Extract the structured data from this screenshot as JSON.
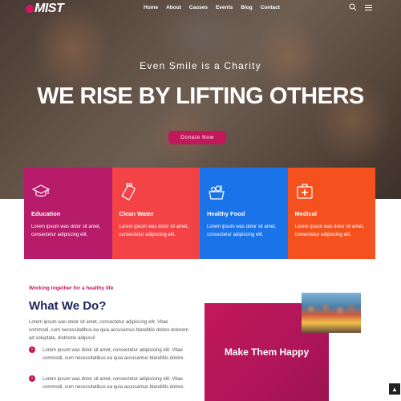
{
  "brand": {
    "logo_text": "MIST"
  },
  "nav": {
    "items": [
      "Home",
      "About",
      "Causes",
      "Events",
      "Blog",
      "Contact"
    ]
  },
  "hero": {
    "subtitle": "Even Smile is a Charity",
    "title": "WE RISE BY LIFTING OTHERS",
    "cta_label": "Donate Now"
  },
  "colors": {
    "accent": "#c2185b",
    "education": "#b71c6a",
    "clean_water": "#f44346",
    "healthy_food": "#1a73e8",
    "medical": "#f4511e"
  },
  "causes": [
    {
      "title": "Education",
      "icon": "graduation-cap-icon",
      "text": "Lorem ipsum was dolor sit amet, consectetur adipiscing elit."
    },
    {
      "title": "Clean Water",
      "icon": "water-bottle-icon",
      "text": "Lorem ipsum was dolor sit amet, consectetur adipiscing elit."
    },
    {
      "title": "Healthy Food",
      "icon": "food-basket-icon",
      "text": "Lorem ipsum was dolor sit amet, consectetur adipiscing elit."
    },
    {
      "title": "Medical",
      "icon": "medical-kit-icon",
      "text": "Lorem ipsum was dolor sit amet, consectetur adipiscing elit."
    }
  ],
  "about": {
    "kicker": "Working together for a healthy life",
    "title": "What We Do?",
    "intro": "Lorem ipsum was dolor sit amet, consectetur adipiscing elit. Vitae commodi, cum necessitatibus ea quia accusamus blanditiis dolore dolorem ad voluptate, distinctio adipisci!",
    "bullets": [
      "Lorem ipsum was dolor sit amet, consectetur adipisicing elit. Vitae commodi, cum necessitatibus ea quia accusamus blanditiis dolore.",
      "Lorem ipsum was dolor sit amet, consectetur adipisicing elit. Vitae commodi, cum necessitatibus ea quia accusamus blanditiis dolore."
    ]
  },
  "promo": {
    "title": "Make Them Happy"
  }
}
